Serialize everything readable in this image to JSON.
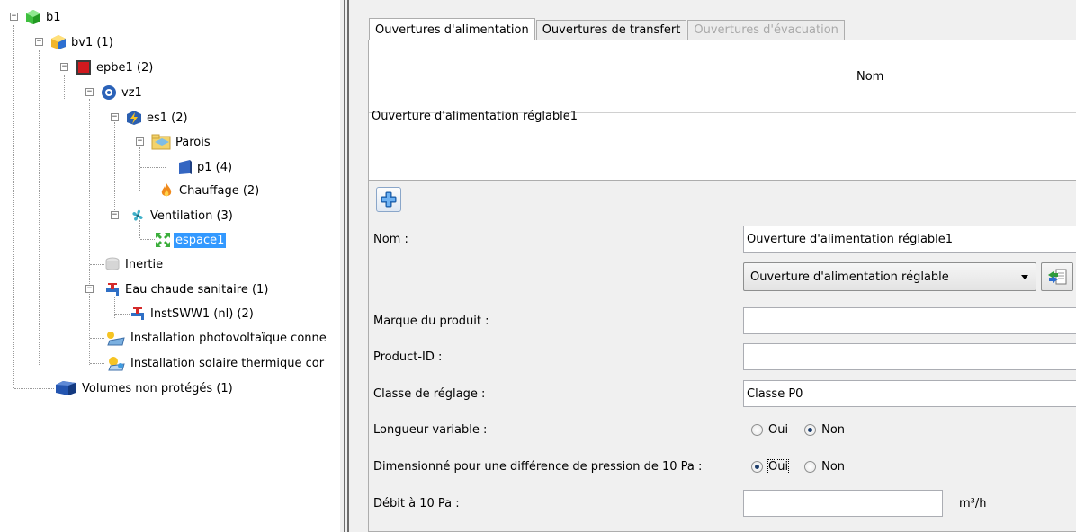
{
  "tree": {
    "nodes": [
      {
        "label": "b1",
        "icon": "green-cube-icon"
      },
      {
        "label": "bv1 (1)",
        "icon": "yellow-blue-cube-icon"
      },
      {
        "label": "epbe1 (2)",
        "icon": "red-cube-icon"
      },
      {
        "label": "vz1",
        "icon": "blue-gear-icon"
      },
      {
        "label": "es1 (2)",
        "icon": "lightning-cube-icon"
      },
      {
        "label": "Parois",
        "icon": "folder-icon"
      },
      {
        "label": "p1 (4)",
        "icon": "wall-panel-icon"
      },
      {
        "label": "Chauffage (2)",
        "icon": "flame-icon"
      },
      {
        "label": "Ventilation (3)",
        "icon": "fan-icon"
      },
      {
        "label": "espace1",
        "icon": "expand-arrows-icon"
      },
      {
        "label": "Inertie",
        "icon": "cylinder-icon"
      },
      {
        "label": "Eau chaude sanitaire (1)",
        "icon": "faucet-icon"
      },
      {
        "label": "InstSWW1 (nl) (2)",
        "icon": "faucet-icon"
      },
      {
        "label": "Installation photovoltaïque conne",
        "icon": "solar-panel-icon"
      },
      {
        "label": "Installation solaire thermique cor",
        "icon": "solar-thermal-icon"
      },
      {
        "label": "Volumes non protégés (1)",
        "icon": "blue-cube-icon"
      }
    ]
  },
  "tabs": [
    {
      "label": "Ouvertures d'alimentation",
      "state": "active"
    },
    {
      "label": "Ouvertures de transfert",
      "state": "normal"
    },
    {
      "label": "Ouvertures d'évacuation",
      "state": "disabled"
    }
  ],
  "grid": {
    "header": "Nom",
    "rows": [
      "Ouverture d'alimentation réglable1"
    ]
  },
  "form": {
    "name_label": "Nom :",
    "name_value": "Ouverture d'alimentation réglable1",
    "type_value": "Ouverture d'alimentation réglable",
    "brand_label": "Marque du produit :",
    "brand_value": "",
    "product_id_label": "Product-ID :",
    "product_id_value": "",
    "class_label": "Classe de réglage :",
    "class_value": "Classe P0",
    "variable_length_label": "Longueur variable :",
    "variable_length_yes": "Oui",
    "variable_length_no": "Non",
    "pressure_label": "Dimensionné pour une différence de pression de 10 Pa :",
    "pressure_yes": "Oui",
    "pressure_no": "Non",
    "flow_label": "Débit à 10 Pa :",
    "flow_value": "",
    "flow_unit": "m³/h"
  },
  "colors": {
    "selection": "#3399ff",
    "panel_bg": "#f0f0f0"
  }
}
